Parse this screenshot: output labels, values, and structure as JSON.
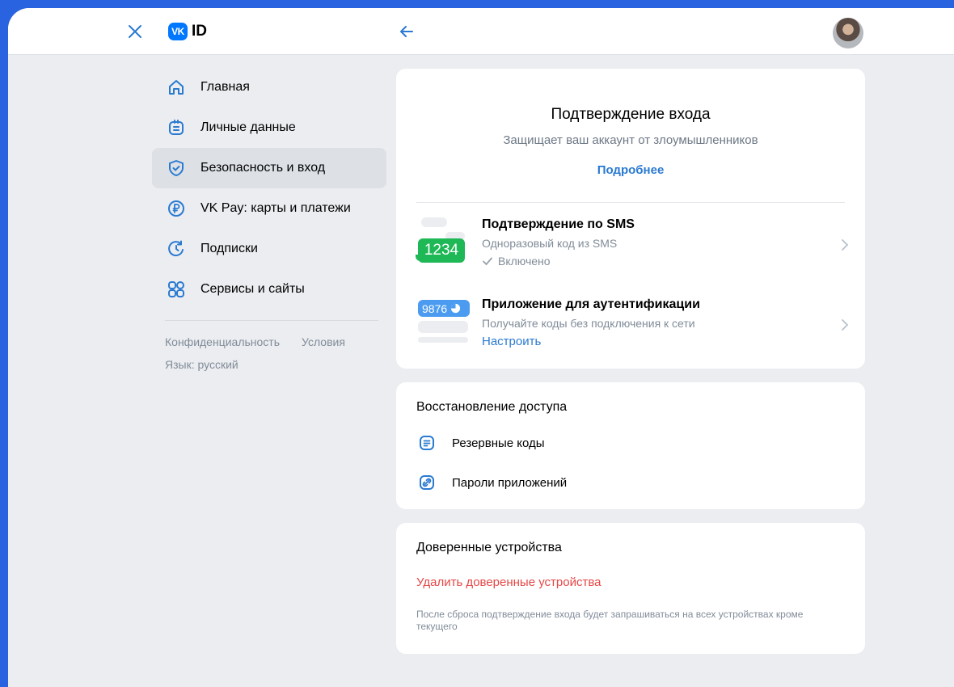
{
  "header": {
    "logo_badge": "VK",
    "logo_text": "ID"
  },
  "sidebar": {
    "items": [
      {
        "label": "Главная",
        "icon": "home-icon"
      },
      {
        "label": "Личные данные",
        "icon": "id-card-icon"
      },
      {
        "label": "Безопасность и вход",
        "icon": "shield-icon",
        "active": true
      },
      {
        "label": "VK Pay: карты и платежи",
        "icon": "ruble-icon"
      },
      {
        "label": "Подписки",
        "icon": "refresh-icon"
      },
      {
        "label": "Сервисы и сайты",
        "icon": "apps-icon"
      }
    ],
    "footer": {
      "privacy": "Конфиденциальность",
      "terms": "Условия",
      "language": "Язык: русский"
    }
  },
  "login_confirmation": {
    "title": "Подтверждение входа",
    "subtitle": "Защищает ваш аккаунт от злоумышленников",
    "more_link": "Подробнее",
    "sms": {
      "code": "1234",
      "title": "Подтверждение по SMS",
      "description": "Одноразовый код из SMS",
      "status": "Включено"
    },
    "app": {
      "code": "9876",
      "title": "Приложение для аутентификации",
      "description": "Получайте коды без подключения к сети",
      "action": "Настроить"
    }
  },
  "recovery": {
    "title": "Восстановление доступа",
    "backup_codes": "Резервные коды",
    "app_passwords": "Пароли приложений"
  },
  "trusted_devices": {
    "title": "Доверенные устройства",
    "delete_action": "Удалить доверенные устройства",
    "note": "После сброса подтверждение входа будет запрашиваться на всех устройствах кроме текущего"
  },
  "colors": {
    "accent": "#2a7ad1",
    "brand": "#0077ff",
    "danger": "#e64646",
    "success": "#1fb856",
    "background": "#2a63e0"
  }
}
